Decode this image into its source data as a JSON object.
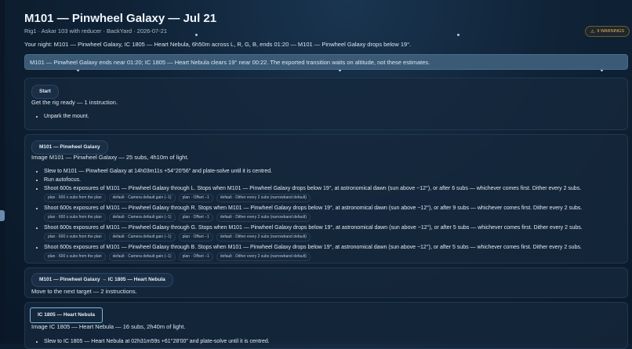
{
  "title": "M101 — Pinwheel Galaxy — Jul 21",
  "subtitle": "Rig1 · Askar 103 with reducer · BackYard · 2026-07-21",
  "warnings_badge": "9 WARNINGS",
  "warning_icon": "warning-triangle-icon",
  "summary": "Your night: M101 — Pinwheel Galaxy, IC 1805 — Heart Nebula, 6h50m across L, R, G, B, ends 01:20 — M101 — Pinwheel Galaxy drops below 19°.",
  "banner": "M101 — Pinwheel Galaxy ends near 01:20; IC 1805 — Heart Nebula clears 19° near 00:22. The exported transition waits on altitude, not these estimates.",
  "cards": [
    {
      "label": "Start",
      "desc": "Get the rig ready — 1 instruction.",
      "items": [
        {
          "text": "Unpark the mount."
        }
      ]
    },
    {
      "label": "M101 — Pinwheel Galaxy",
      "desc": "Image M101 — Pinwheel Galaxy — 25 subs, 4h10m of light.",
      "items": [
        {
          "text": "Slew to M101 — Pinwheel Galaxy at 14h03m11s +54°20′56″ and plate-solve until it is centred."
        },
        {
          "text": "Run autofocus."
        },
        {
          "text": "Shoot 600s exposures of M101 — Pinwheel Galaxy through L. Stops when M101 — Pinwheel Galaxy drops below 19°, at astronomical dawn (sun above −12°), or after 6 subs — whichever comes first. Dither every 2 subs.",
          "chips": [
            "plan · 600 s subs from the plan",
            "default · Camera default gain (−1)",
            "plan · Offset −1",
            "default · Dither every 2 subs (narrowband default)"
          ]
        },
        {
          "text": "Shoot 600s exposures of M101 — Pinwheel Galaxy through R. Stops when M101 — Pinwheel Galaxy drops below 19°, at astronomical dawn (sun above −12°), or after 9 subs — whichever comes first. Dither every 2 subs.",
          "chips": [
            "plan · 600 s subs from the plan",
            "default · Camera default gain (−1)",
            "plan · Offset −1",
            "default · Dither every 2 subs (narrowband default)"
          ]
        },
        {
          "text": "Shoot 600s exposures of M101 — Pinwheel Galaxy through G. Stops when M101 — Pinwheel Galaxy drops below 19°, at astronomical dawn (sun above −12°), or after 5 subs — whichever comes first. Dither every 2 subs.",
          "chips": [
            "plan · 600 s subs from the plan",
            "default · Camera default gain (−1)",
            "plan · Offset −1",
            "default · Dither every 2 subs (narrowband default)"
          ]
        },
        {
          "text": "Shoot 600s exposures of M101 — Pinwheel Galaxy through B. Stops when M101 — Pinwheel Galaxy drops below 19°, at astronomical dawn (sun above −12°), or after 5 subs — whichever comes first. Dither every 2 subs.",
          "chips": [
            "plan · 600 s subs from the plan",
            "default · Camera default gain (−1)",
            "plan · Offset −1",
            "default · Dither every 2 subs (narrowband default)"
          ]
        }
      ]
    },
    {
      "label": "M101 — Pinwheel Galaxy → IC 1805 — Heart Nebula",
      "desc": "Move to the next target — 2 instructions.",
      "items": []
    },
    {
      "label": "IC 1805 — Heart Nebula",
      "desc": "Image IC 1805 — Heart Nebula — 16 subs, 2h40m of light.",
      "items": [
        {
          "text": "Slew to IC 1805 — Heart Nebula at 02h31m59s +61°28′00″ and plate-solve until it is centred."
        }
      ]
    }
  ]
}
